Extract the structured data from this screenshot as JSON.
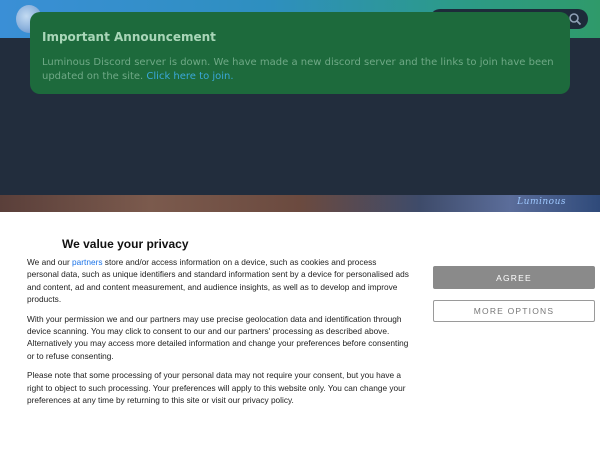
{
  "site": {
    "logo_icon": "mascot-logo-icon",
    "search": {
      "placeholder": "",
      "icon": "search-icon"
    }
  },
  "announcement": {
    "title": "Important Announcement",
    "text": "Luminous Discord server is down. We have made a new discord server and the links to join have been updated on the site.",
    "link_text": "Click here to join."
  },
  "banner": {
    "logo_text": "Luminous"
  },
  "consent": {
    "title": "We value your privacy",
    "p1_before": "We and our ",
    "p1_link": "partners",
    "p1_after": " store and/or access information on a device, such as cookies and process personal data, such as unique identifiers and standard information sent by a device for personalised ads and content, ad and content measurement, and audience insights, as well as to develop and improve products.",
    "p2": "With your permission we and our partners may use precise geolocation data and identification through device scanning. You may click to consent to our and our partners' processing as described above. Alternatively you may access more detailed information and change your preferences before consenting or to refuse consenting.",
    "p3": "Please note that some processing of your personal data may not require your consent, but you have a right to object to such processing. Your preferences will apply to this website only. You can change your preferences at any time by returning to this site or visit our privacy policy.",
    "agree_label": "AGREE",
    "more_options_label": "MORE OPTIONS"
  },
  "colors": {
    "announcement_bg": "#1d6a3c",
    "link": "#3aa8d8",
    "agree_bg": "#8a8a8a"
  }
}
